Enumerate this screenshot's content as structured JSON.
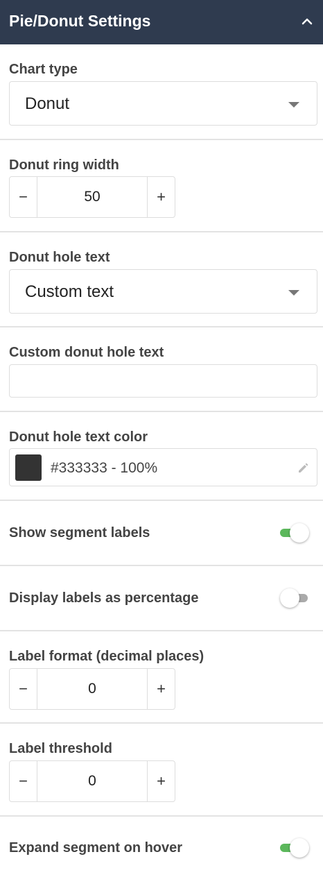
{
  "header": {
    "title": "Pie/Donut Settings",
    "collapse_icon": "chevron-up-icon"
  },
  "chart_type": {
    "label": "Chart type",
    "value": "Donut"
  },
  "ring_width": {
    "label": "Donut ring width",
    "value": "50",
    "minus": "−",
    "plus": "+"
  },
  "hole_text": {
    "label": "Donut hole text",
    "value": "Custom text"
  },
  "custom_hole_text": {
    "label": "Custom donut hole text",
    "value": ""
  },
  "hole_text_color": {
    "label": "Donut hole text color",
    "value": "#333333 - 100%",
    "swatch": "#333333"
  },
  "segment_labels": {
    "label": "Show segment labels",
    "enabled": true
  },
  "percentage_labels": {
    "label": "Display labels as percentage",
    "enabled": false
  },
  "label_format": {
    "label": "Label format (decimal places)",
    "value": "0",
    "minus": "−",
    "plus": "+"
  },
  "label_threshold": {
    "label": "Label threshold",
    "value": "0",
    "minus": "−",
    "plus": "+"
  },
  "expand_hover": {
    "label": "Expand segment on hover",
    "enabled": true
  },
  "colors": {
    "header_bg": "#2f3b4f",
    "toggle_on": "#5cb85c",
    "toggle_off": "#aaaaaa"
  }
}
